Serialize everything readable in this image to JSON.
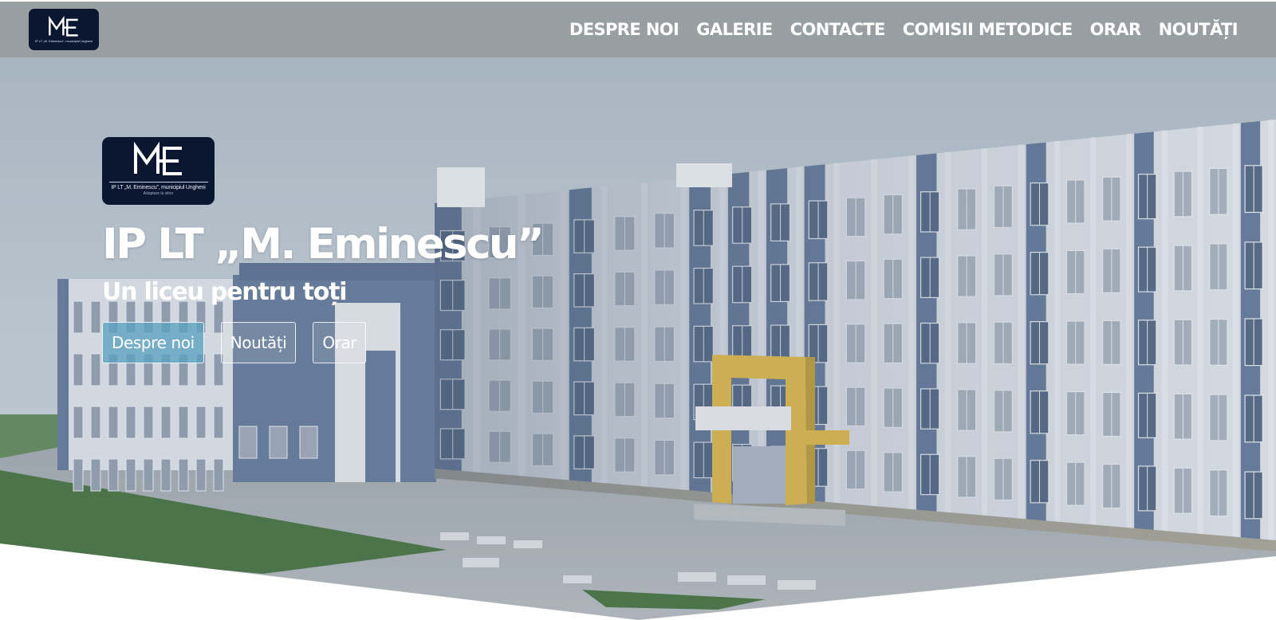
{
  "site": {
    "logo_text": "IP LT „M. Eminescu”, municipiul Ungheni",
    "logo_tagline": "Adaptare la viitor",
    "logo_monogram": "ME"
  },
  "nav": {
    "items": [
      {
        "label": "DESPRE NOI"
      },
      {
        "label": "GALERIE"
      },
      {
        "label": "CONTACTE"
      },
      {
        "label": "COMISII METODICE"
      },
      {
        "label": "ORAR"
      },
      {
        "label": "NOUTĂȚI"
      }
    ]
  },
  "hero": {
    "title": "IP LT „M. Eminescu”",
    "subtitle": "Un liceu pentru toți",
    "buttons": [
      {
        "label": "Despre noi"
      },
      {
        "label": "Noutăți"
      },
      {
        "label": "Orar"
      }
    ]
  },
  "colors": {
    "nav_bar": "#969da1",
    "logo_background": "#0b1630",
    "primary_button": "#5ca1c1",
    "facade_blue": "#5d7394",
    "facade_white": "#e3e6ea",
    "entrance_yellow": "#d9b23c",
    "lawn_green": "#3e6b34",
    "sky": "#b9c6cf"
  }
}
